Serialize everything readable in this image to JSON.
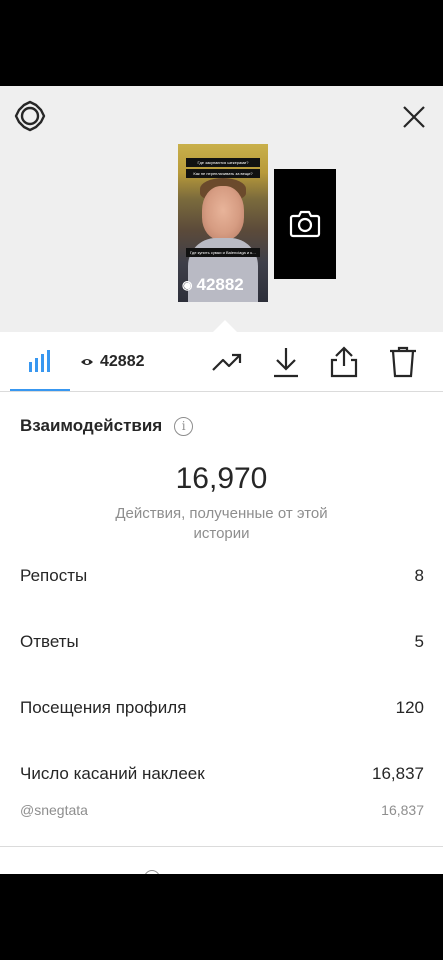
{
  "preview": {
    "story_views_overlay": "42882",
    "story_caption_lines": [
      "Где закупаются шекерами?",
      "Как не переплачивать за вещи?",
      "Где купить сумки и Balenciaga и к…"
    ]
  },
  "toolbar": {
    "views_count": "42882"
  },
  "section": {
    "title": "Взаимодействия",
    "info_glyph": "i"
  },
  "summary": {
    "total": "16,970",
    "caption": "Действия, полученные от этой истории"
  },
  "rows": [
    {
      "label": "Репосты",
      "value": "8"
    },
    {
      "label": "Ответы",
      "value": "5"
    },
    {
      "label": "Посещения профиля",
      "value": "120"
    },
    {
      "label": "Число касаний наклеек",
      "value": "16,837"
    }
  ],
  "sticker_rows": [
    {
      "label": "@snegtata",
      "value": "16,837"
    }
  ],
  "colors": {
    "accent": "#3897f0",
    "text_primary": "#262626",
    "text_secondary": "#8e8e8e",
    "divider": "#dbdbdb",
    "preview_bg": "#efefef"
  }
}
